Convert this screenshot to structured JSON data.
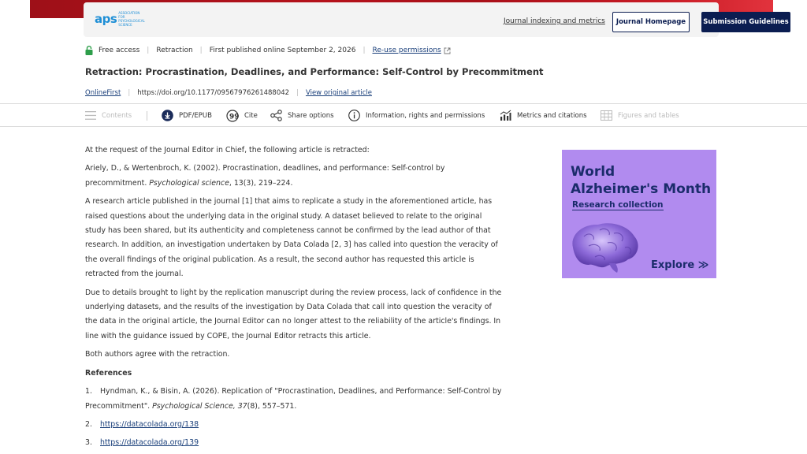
{
  "header": {
    "logo_mark": "aps",
    "logo_text": "ASSOCIATION FOR PSYCHOLOGICAL SCIENCE",
    "indexing_link": "Journal indexing and metrics",
    "homepage_button": "Journal Homepage",
    "submission_button": "Submission Guidelines"
  },
  "meta": {
    "access": "Free access",
    "type": "Retraction",
    "published": "First published online September 2, 2026",
    "permissions": "Re-use permissions"
  },
  "title": "Retraction: Procrastination, Deadlines, and Performance: Self-Control by Precommitment",
  "doi_row": {
    "section": "OnlineFirst",
    "doi": "https://doi.org/10.1177/09567976261488042",
    "view_original": "View original article"
  },
  "toolbar": {
    "contents": "Contents",
    "pdf": "PDF/EPUB",
    "cite": "Cite",
    "share": "Share options",
    "info": "Information, rights and permissions",
    "metrics": "Metrics and citations",
    "figures": "Figures and tables"
  },
  "article": {
    "p1": "At the request of the Journal Editor in Chief, the following article is retracted:",
    "citation_main": "Ariely, D., & Wertenbroch, K. (2002). Procrastination, deadlines, and performance: Self-control by precommitment. ",
    "citation_journal": "Psychological science",
    "citation_vol": ", 13",
    "citation_rest": "(3), 219–224.",
    "p2": "A research article published in the journal [1] that aims to replicate a study in the aforementioned article, has raised questions about the underlying data in the original study. A dataset believed to relate to the original study has been shared, but its authenticity and completeness cannot be confirmed by the lead author of that research. In addition, an investigation undertaken by Data Colada [2, 3] has called into question the veracity of the overall findings of the original publication. As a result, the second author has requested this article is retracted from the journal.",
    "p3": "Due to details brought to light by the replication manuscript during the review process, lack of confidence in the underlying datasets, and the results of the investigation by Data Colada that call into question the veracity of the data in the original article, the Journal Editor can no longer attest to the reliability of the article's findings. In line with the guidance issued by COPE, the Journal Editor retracts this article.",
    "p4": "Both authors agree with the retraction.",
    "references_heading": "References",
    "ref1_num": "1.",
    "ref1_main": "Hyndman, K., & Bisin, A. (2026). Replication of \"Procrastination, Deadlines, and Performance: Self-Control by Precommitment\". ",
    "ref1_journal": "Psychological Science, 37",
    "ref1_rest": "(8), 557–571.",
    "ref2_num": "2.",
    "ref2_link": "https://datacolada.org/138",
    "ref3_num": "3.",
    "ref3_link": "https://datacolada.org/139"
  },
  "ad": {
    "line1": "World",
    "line2": "Alzheimer's Month",
    "sub": "Research collection",
    "explore": "Explore ≫",
    "background": "#b18bef"
  }
}
